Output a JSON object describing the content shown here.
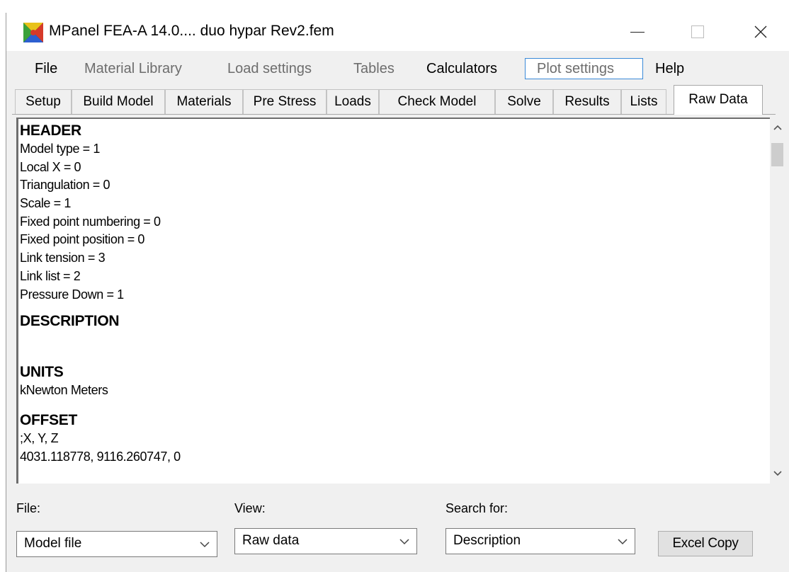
{
  "window": {
    "title": "MPanel FEA-A 14.0.... duo hypar Rev2.fem"
  },
  "menu": [
    {
      "label": "File",
      "enabled": true
    },
    {
      "label": "Material Library",
      "enabled": false
    },
    {
      "label": "Load settings",
      "enabled": false
    },
    {
      "label": "Tables",
      "enabled": false
    },
    {
      "label": "Calculators",
      "enabled": true
    },
    {
      "label": "Plot settings",
      "enabled": false
    },
    {
      "label": "Help",
      "enabled": true
    }
  ],
  "tabs": [
    {
      "label": "Setup"
    },
    {
      "label": "Build Model"
    },
    {
      "label": "Materials"
    },
    {
      "label": "Pre Stress"
    },
    {
      "label": "Loads"
    },
    {
      "label": "Check Model"
    },
    {
      "label": "Solve"
    },
    {
      "label": "Results"
    },
    {
      "label": "Lists"
    },
    {
      "label": "Raw Data",
      "active": true
    }
  ],
  "raw_data": {
    "header_title": "HEADER",
    "header_lines": [
      "Model type = 1",
      "Local X = 0",
      "Triangulation = 0",
      "Scale = 1",
      "Fixed point numbering = 0",
      "Fixed point position = 0",
      "Link tension = 3",
      "Link list = 2",
      "Pressure Down = 1"
    ],
    "description_title": "DESCRIPTION",
    "units_title": "UNITS",
    "units_value": "kNewton Meters",
    "offset_title": "OFFSET",
    "offset_lines": [
      ";X, Y, Z",
      "4031.118778, 9116.260747, 0"
    ]
  },
  "bottom": {
    "file_label": "File:",
    "file_value": "Model file",
    "view_label": "View:",
    "view_value": "Raw data",
    "search_label": "Search for:",
    "search_value": "Description",
    "excel_button": "Excel Copy"
  },
  "scroll_position_fraction": 0.0
}
